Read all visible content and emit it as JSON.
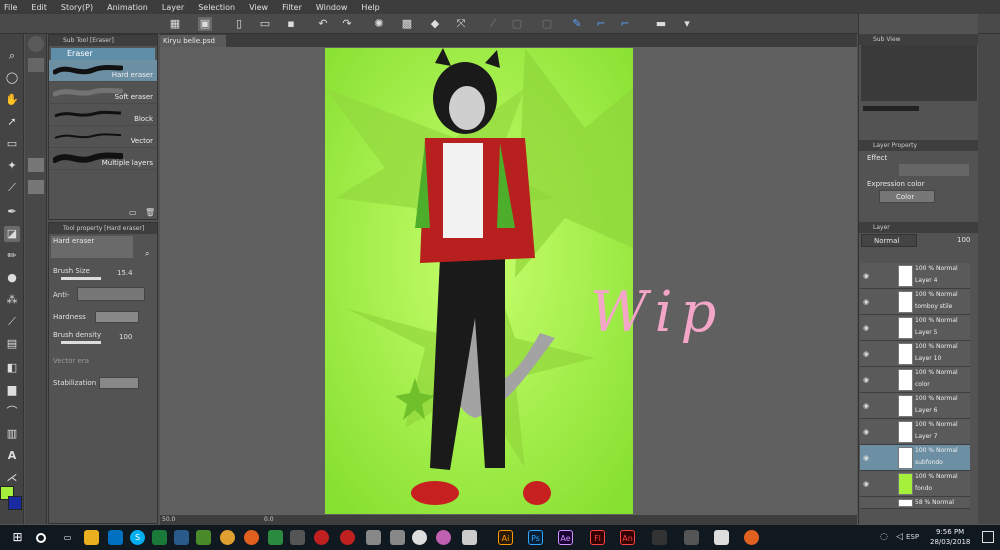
{
  "menu": [
    "File",
    "Edit",
    "Story(P)",
    "Animation",
    "Layer",
    "Selection",
    "View",
    "Filter",
    "Window",
    "Help"
  ],
  "subtool": {
    "title": "Sub Tool [Eraser]",
    "group": "Eraser",
    "brushes": [
      "Hard eraser",
      "Soft eraser",
      "Block",
      "Vector",
      "Multiple layers"
    ]
  },
  "toolprop": {
    "title": "Tool property [Hard eraser]",
    "preset": "Hard eraser",
    "brush_size_label": "Brush Size",
    "brush_size": "15.4",
    "anti_label": "Anti-",
    "hardness_label": "Hardness",
    "density_label": "Brush density",
    "density": "100",
    "vector_label": "Vector era",
    "stabilization_label": "Stabilization"
  },
  "document": {
    "tab": "Kiryu belle.psd",
    "zoom": "50.0",
    "angle": "0.0",
    "overlay_text": "Wip"
  },
  "subview": {
    "title": "Sub View"
  },
  "layer_property": {
    "title": "Layer Property",
    "effect_label": "Effect",
    "expression_label": "Expression color",
    "expression_value": "Color"
  },
  "layer_panel": {
    "title": "Layer",
    "blend": "Normal",
    "opacity": "100",
    "layers": [
      {
        "mode": "100 %  Normal",
        "name": "Layer 4"
      },
      {
        "mode": "100 %  Normal",
        "name": "tomboy stile"
      },
      {
        "mode": "100 %  Normal",
        "name": "Layer 5"
      },
      {
        "mode": "100 %  Normal",
        "name": "Layer 10"
      },
      {
        "mode": "100 %  Normal",
        "name": "color"
      },
      {
        "mode": "100 %  Normal",
        "name": "Layer 6"
      },
      {
        "mode": "100 %  Normal",
        "name": "Layer 7"
      },
      {
        "mode": "100 %  Normal",
        "name": "subfondo"
      },
      {
        "mode": "100 %  Normal",
        "name": "fondo"
      },
      {
        "mode": "58 %  Normal",
        "name": ""
      }
    ]
  },
  "taskbar": {
    "time": "9:56 PM",
    "date": "28/03/2018",
    "lang": "ESP"
  },
  "colors": {
    "main": "#a5f03a",
    "sub": "#1a2aa0",
    "accent": "#6d8fa4"
  }
}
